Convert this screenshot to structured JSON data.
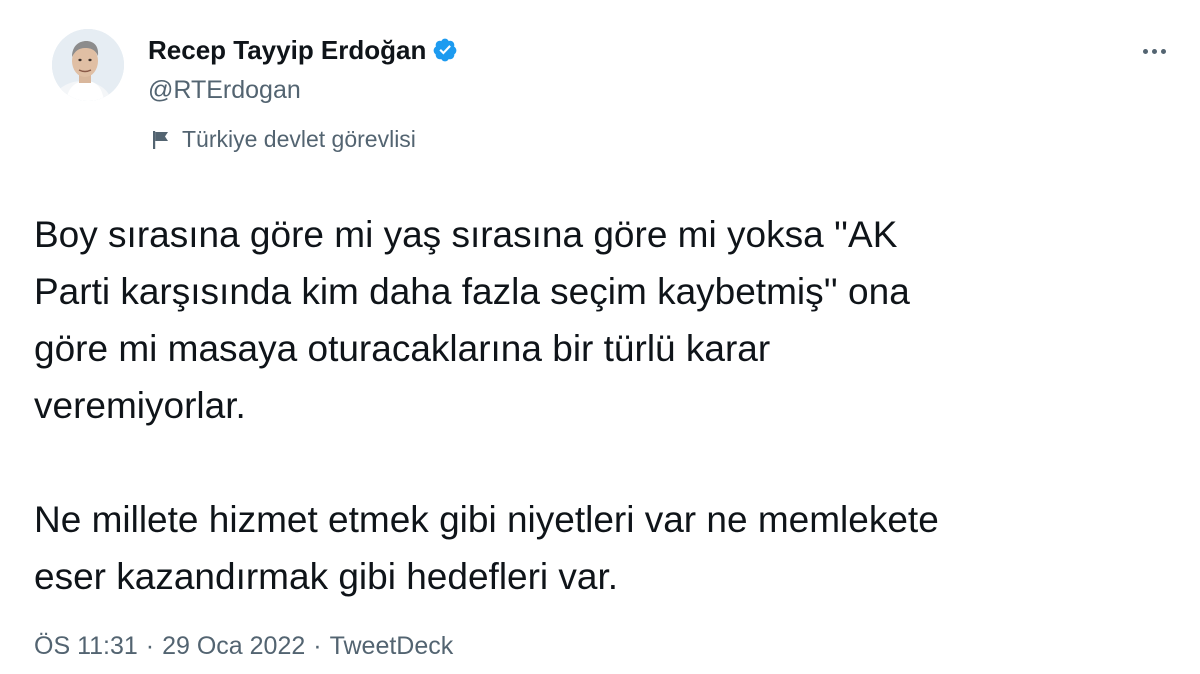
{
  "author": {
    "name": "Recep Tayyip Erdoğan",
    "handle": "@RTErdogan",
    "verified_icon": "verified-badge-icon",
    "label": "Türkiye devlet görevlisi",
    "label_icon": "flag-icon"
  },
  "menu": {
    "icon": "more-icon"
  },
  "tweet": {
    "paragraphs": [
      "Boy sırasına göre mi yaş sırasına göre mi yoksa ''AK\nParti karşısında kim daha fazla seçim kaybetmiş'' ona\ngöre mi masaya oturacaklarına bir türlü karar\nveremiyorlar.",
      "Ne millete hizmet etmek gibi niyetleri var ne memlekete\neser kazandırmak gibi hedefleri var."
    ]
  },
  "meta": {
    "time": "ÖS 11:31",
    "date": "29 Oca 2022",
    "separator": "·",
    "source": "TweetDeck"
  },
  "colors": {
    "text": "#0f1419",
    "secondary": "#536471",
    "verified": "#1d9bf0",
    "background": "#ffffff"
  }
}
